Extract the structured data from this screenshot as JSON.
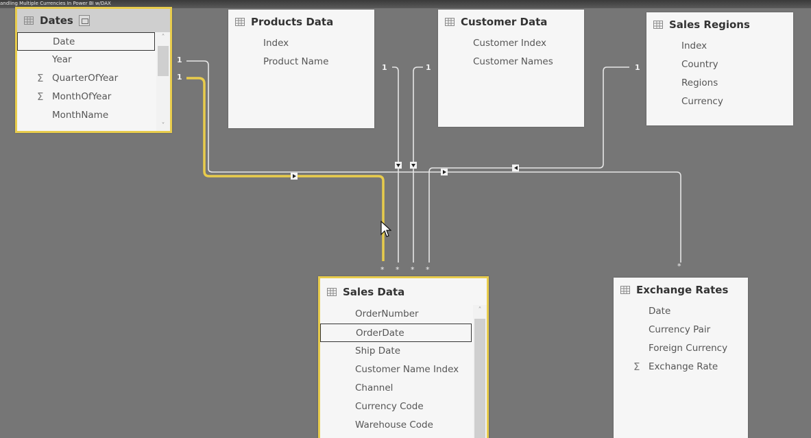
{
  "video_title": "andling Multiple Currencies In Power BI w/DAX",
  "colors": {
    "canvas": "#767676",
    "selection": "#e8cc4c",
    "card": "#f6f6f6",
    "line": "#e6e6e6"
  },
  "tables": {
    "dates": {
      "title": "Dates",
      "fields": [
        {
          "name": "Date",
          "sigma": false
        },
        {
          "name": "Year",
          "sigma": false
        },
        {
          "name": "QuarterOfYear",
          "sigma": true
        },
        {
          "name": "MonthOfYear",
          "sigma": true
        },
        {
          "name": "MonthName",
          "sigma": false
        }
      ]
    },
    "products": {
      "title": "Products Data",
      "fields": [
        {
          "name": "Index"
        },
        {
          "name": "Product Name"
        }
      ]
    },
    "customer": {
      "title": "Customer Data",
      "fields": [
        {
          "name": "Customer Index"
        },
        {
          "name": "Customer Names"
        }
      ]
    },
    "regions": {
      "title": "Sales Regions",
      "fields": [
        {
          "name": "Index"
        },
        {
          "name": "Country"
        },
        {
          "name": "Regions"
        },
        {
          "name": "Currency"
        }
      ]
    },
    "sales": {
      "title": "Sales Data",
      "fields": [
        {
          "name": "OrderNumber"
        },
        {
          "name": "OrderDate"
        },
        {
          "name": "Ship Date"
        },
        {
          "name": "Customer Name Index"
        },
        {
          "name": "Channel"
        },
        {
          "name": "Currency Code"
        },
        {
          "name": "Warehouse Code"
        }
      ]
    },
    "exchange": {
      "title": "Exchange Rates",
      "fields": [
        {
          "name": "Date",
          "sigma": false
        },
        {
          "name": "Currency Pair",
          "sigma": false
        },
        {
          "name": "Foreign Currency",
          "sigma": false
        },
        {
          "name": "Exchange Rate",
          "sigma": true
        }
      ]
    }
  },
  "relationships": {
    "one_label": "1",
    "many_label": "*",
    "sigma_symbol": "Σ",
    "scroll_up": "˄",
    "scroll_down": "˅"
  }
}
